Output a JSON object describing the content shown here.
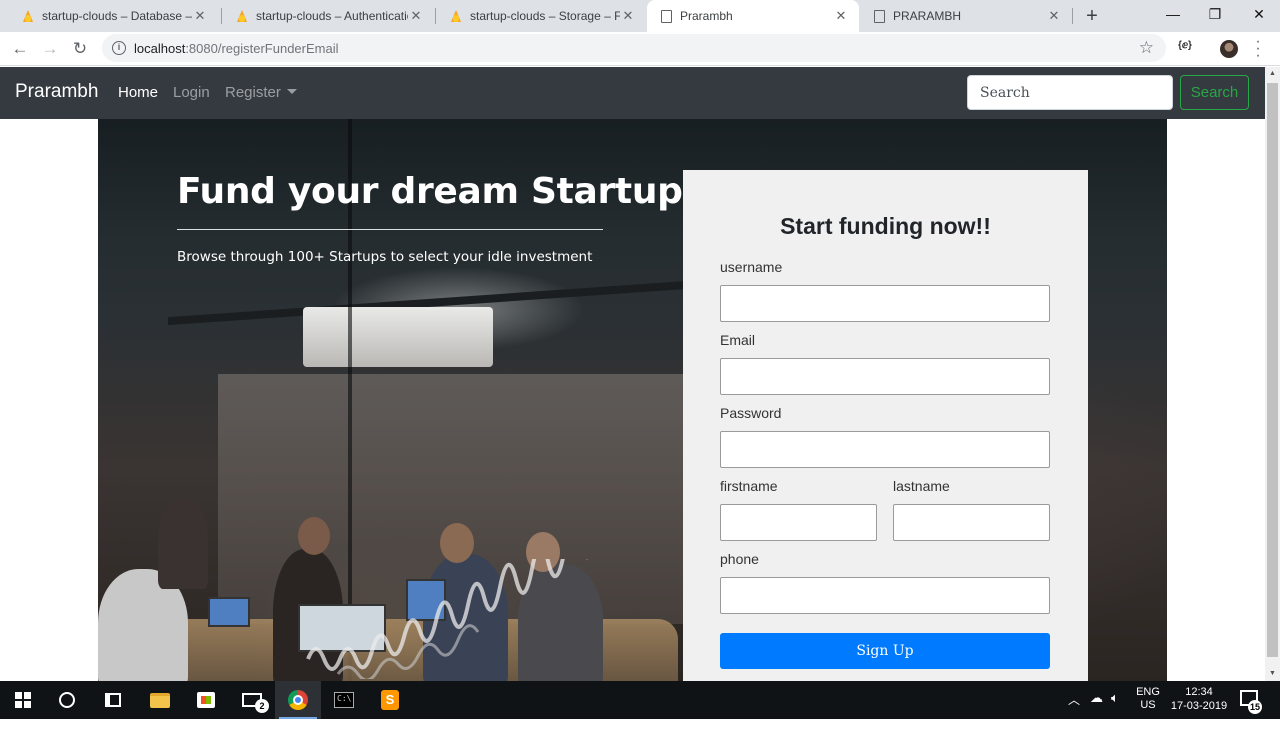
{
  "browser": {
    "tabs": [
      {
        "label": "startup-clouds – Database – Fir",
        "icon": "firebase-icon",
        "active": false
      },
      {
        "label": "startup-clouds – Authenticatio",
        "icon": "firebase-icon",
        "active": false
      },
      {
        "label": "startup-clouds – Storage – Fire",
        "icon": "firebase-icon",
        "active": false
      },
      {
        "label": "Prarambh",
        "icon": "page-icon",
        "active": true
      },
      {
        "label": "PRARAMBH",
        "icon": "page-icon",
        "active": false
      }
    ],
    "url_host": "localhost",
    "url_path": ":8080/registerFunderEmail",
    "extension_label": "{ⅇ}"
  },
  "navbar": {
    "brand": "Prarambh",
    "links": [
      {
        "label": "Home",
        "active": true
      },
      {
        "label": "Login",
        "active": false
      },
      {
        "label": "Register",
        "active": false,
        "dropdown": true
      }
    ],
    "search_placeholder": "Search",
    "search_button": "Search"
  },
  "hero": {
    "title": "Fund your dream Startup",
    "subtitle": "Browse through 100+ Startups to select your idle investment"
  },
  "form": {
    "title": "Start funding now!!",
    "fields": {
      "username": "username",
      "email": "Email",
      "password": "Password",
      "firstname": "firstname",
      "lastname": "lastname",
      "phone": "phone"
    },
    "submit": "Sign Up"
  },
  "taskbar": {
    "mail_badge": "2",
    "lang_top": "ENG",
    "lang_bottom": "US",
    "time": "12:34",
    "date": "17-03-2019",
    "notifications": "15"
  },
  "colors": {
    "navbar_bg": "#343a40",
    "success": "#28a745",
    "primary": "#007bff",
    "card_bg": "#f0f0f0"
  }
}
